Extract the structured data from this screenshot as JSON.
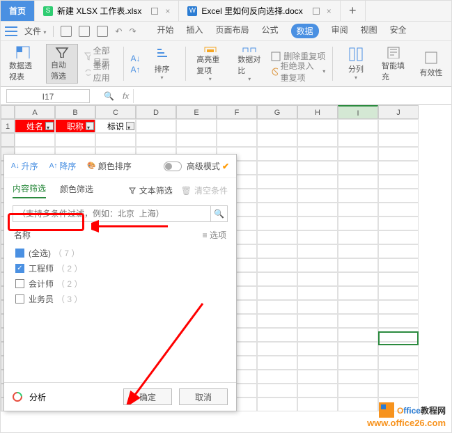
{
  "tabs": {
    "home": "首页",
    "file1": "新建 XLSX 工作表.xlsx",
    "file2": "Excel 里如何反向选择.docx"
  },
  "menu": {
    "file": "文件",
    "items": [
      "开始",
      "插入",
      "页面布局",
      "公式",
      "数据",
      "审阅",
      "视图",
      "安全"
    ],
    "active": "数据"
  },
  "ribbon": {
    "pivot": "数据透视表",
    "autofilter": "自动筛选",
    "showall": "全部显示",
    "reapply": "重新应用",
    "sort_sym_asc": "A↓",
    "sort_sym_desc": "A↑",
    "sort": "排序",
    "highlight_dup": "高亮重复项",
    "compare": "数据对比",
    "del_dup": "删除重复项",
    "reject_dup": "拒绝录入重复项",
    "split": "分列",
    "smartfill": "智能填充",
    "validate": "有效性"
  },
  "namebox": "I17",
  "fx": "fx",
  "columns": [
    "A",
    "B",
    "C",
    "D",
    "E",
    "F",
    "G",
    "H",
    "I",
    "J"
  ],
  "row1": {
    "a": "姓名",
    "b": "职称",
    "c": "标识"
  },
  "rownum": "1",
  "filter": {
    "asc": "升序",
    "desc": "降序",
    "colorSort": "颜色排序",
    "adv": "高级模式",
    "tab_content": "内容筛选",
    "tab_color": "颜色筛选",
    "text_filter": "文本筛选",
    "clear": "清空条件",
    "placeholder": "（支持多条件过滤，例如：北京  上海）",
    "col_name": "名称",
    "options_lbl": "选项",
    "all": "(全选)",
    "all_cnt": "（ 7 ）",
    "items": [
      {
        "label": "工程师",
        "cnt": "（ 2 ）",
        "checked": true
      },
      {
        "label": "会计师",
        "cnt": "（ 2 ）",
        "checked": false
      },
      {
        "label": "业务员",
        "cnt": "（ 3 ）",
        "checked": false
      }
    ],
    "analysis": "分析",
    "ok": "确定",
    "cancel": "取消"
  },
  "watermark": {
    "brand": "Office教程网",
    "url": "www.office26.com"
  },
  "chart_data": null
}
